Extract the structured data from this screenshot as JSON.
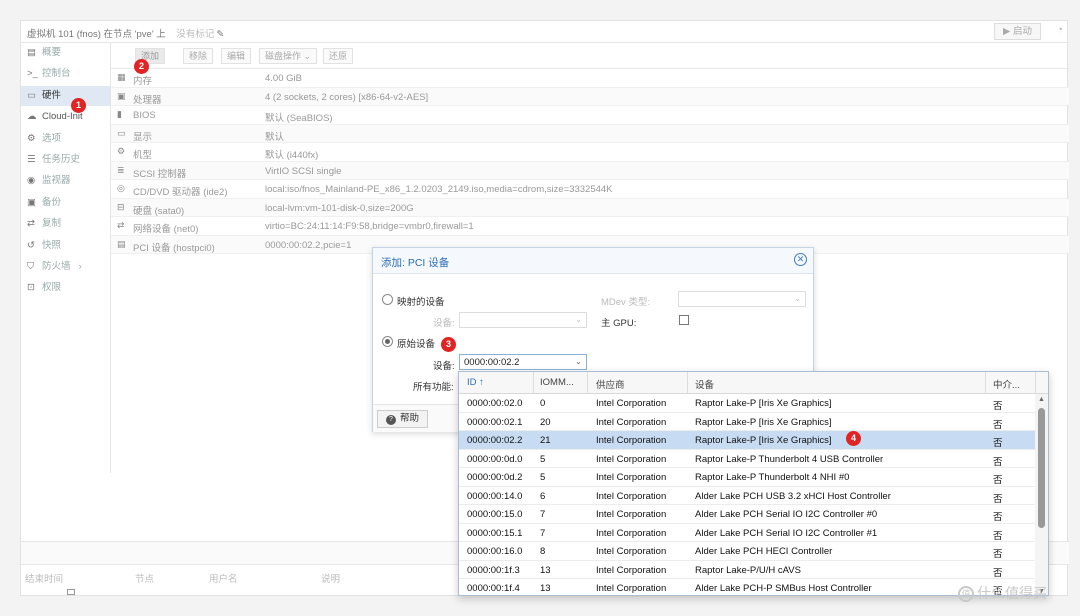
{
  "titlebar": {
    "title": "虚拟机 101 (fnos) 在节点 'pve' 上",
    "tags_label": "没有标记",
    "start_label": "▶ 启动"
  },
  "nav": {
    "items": [
      {
        "label": "概要",
        "icon": "book-icon"
      },
      {
        "label": "控制台",
        "icon": "terminal-icon"
      },
      {
        "label": "硬件",
        "icon": "monitor-icon"
      },
      {
        "label": "Cloud-Init",
        "icon": "cloud-icon"
      },
      {
        "label": "选项",
        "icon": "gear-icon"
      },
      {
        "label": "任务历史",
        "icon": "list-icon"
      },
      {
        "label": "监视器",
        "icon": "eye-icon"
      },
      {
        "label": "备份",
        "icon": "floppy-icon"
      },
      {
        "label": "复制",
        "icon": "retweet-icon"
      },
      {
        "label": "快照",
        "icon": "history-icon"
      },
      {
        "label": "防火墙",
        "icon": "shield-icon"
      },
      {
        "label": "权限",
        "icon": "unlock-icon"
      }
    ],
    "firewall_arrow": "›"
  },
  "toolbar": {
    "add": "添加",
    "remove": "移除",
    "edit": "编辑",
    "disk_action": "磁盘操作",
    "revert": "还原"
  },
  "hardware": [
    {
      "name": "内存",
      "value": "4.00 GiB",
      "icon": "memory-icon"
    },
    {
      "name": "处理器",
      "value": "4 (2 sockets, 2 cores) [x86-64-v2-AES]",
      "icon": "cpu-icon"
    },
    {
      "name": "BIOS",
      "value": "默认 (SeaBIOS)",
      "icon": "chip-icon"
    },
    {
      "name": "显示",
      "value": "默认",
      "icon": "desktop-icon"
    },
    {
      "name": "机型",
      "value": "默认 (i440fx)",
      "icon": "cogs-icon"
    },
    {
      "name": "SCSI 控制器",
      "value": "VirtIO SCSI single",
      "icon": "database-icon"
    },
    {
      "name": "CD/DVD 驱动器 (ide2)",
      "value": "local:iso/fnos_Mainland-PE_x86_1.2.0203_2149.iso,media=cdrom,size=3332544K",
      "icon": "disc-icon"
    },
    {
      "name": "硬盘 (sata0)",
      "value": "local-lvm:vm-101-disk-0,size=200G",
      "icon": "hdd-icon"
    },
    {
      "name": "网络设备 (net0)",
      "value": "virtio=BC:24:11:14:F9:58,bridge=vmbr0,firewall=1",
      "icon": "exchange-icon"
    },
    {
      "name": "PCI 设备 (hostpci0)",
      "value": "0000:00:02.2,pcie=1",
      "icon": "pci-icon"
    }
  ],
  "log": {
    "headers": [
      "结束时间",
      "节点",
      "用户名",
      "说明"
    ]
  },
  "dialog": {
    "title": "添加: PCI 设备",
    "mapped_label": "映射的设备",
    "mapped_device_label": "设备:",
    "mdev_label": "MDev 类型:",
    "primary_gpu_label": "主 GPU:",
    "raw_label": "原始设备",
    "raw_device_label": "设备:",
    "raw_device_value": "0000:00:02.2",
    "all_functions_label": "所有功能:",
    "help_label": "帮助"
  },
  "dropdown": {
    "columns": [
      "ID ↑",
      "IOMM...",
      "供应商",
      "设备",
      "中介..."
    ],
    "rows": [
      {
        "id": "0000:00:02.0",
        "iommu": "0",
        "vendor": "Intel Corporation",
        "device": "Raptor Lake-P [Iris Xe Graphics]",
        "mdev": "否"
      },
      {
        "id": "0000:00:02.1",
        "iommu": "20",
        "vendor": "Intel Corporation",
        "device": "Raptor Lake-P [Iris Xe Graphics]",
        "mdev": "否"
      },
      {
        "id": "0000:00:02.2",
        "iommu": "21",
        "vendor": "Intel Corporation",
        "device": "Raptor Lake-P [Iris Xe Graphics]",
        "mdev": "否"
      },
      {
        "id": "0000:00:0d.0",
        "iommu": "5",
        "vendor": "Intel Corporation",
        "device": "Raptor Lake-P Thunderbolt 4 USB Controller",
        "mdev": "否"
      },
      {
        "id": "0000:00:0d.2",
        "iommu": "5",
        "vendor": "Intel Corporation",
        "device": "Raptor Lake-P Thunderbolt 4 NHI #0",
        "mdev": "否"
      },
      {
        "id": "0000:00:14.0",
        "iommu": "6",
        "vendor": "Intel Corporation",
        "device": "Alder Lake PCH USB 3.2 xHCI Host Controller",
        "mdev": "否"
      },
      {
        "id": "0000:00:15.0",
        "iommu": "7",
        "vendor": "Intel Corporation",
        "device": "Alder Lake PCH Serial IO I2C Controller #0",
        "mdev": "否"
      },
      {
        "id": "0000:00:15.1",
        "iommu": "7",
        "vendor": "Intel Corporation",
        "device": "Alder Lake PCH Serial IO I2C Controller #1",
        "mdev": "否"
      },
      {
        "id": "0000:00:16.0",
        "iommu": "8",
        "vendor": "Intel Corporation",
        "device": "Alder Lake PCH HECI Controller",
        "mdev": "否"
      },
      {
        "id": "0000:00:1f.3",
        "iommu": "13",
        "vendor": "Intel Corporation",
        "device": "Raptor Lake-P/U/H cAVS",
        "mdev": "否"
      },
      {
        "id": "0000:00:1f.4",
        "iommu": "13",
        "vendor": "Intel Corporation",
        "device": "Alder Lake PCH-P SMBus Host Controller",
        "mdev": "否"
      }
    ],
    "selected_index": 2
  },
  "annotations": [
    "1",
    "2",
    "3",
    "4"
  ],
  "watermark": "什么值得买",
  "colors": {
    "accent": "#2a6ebb",
    "selected_row": "#c7dbf2",
    "badge": "#e02424"
  }
}
